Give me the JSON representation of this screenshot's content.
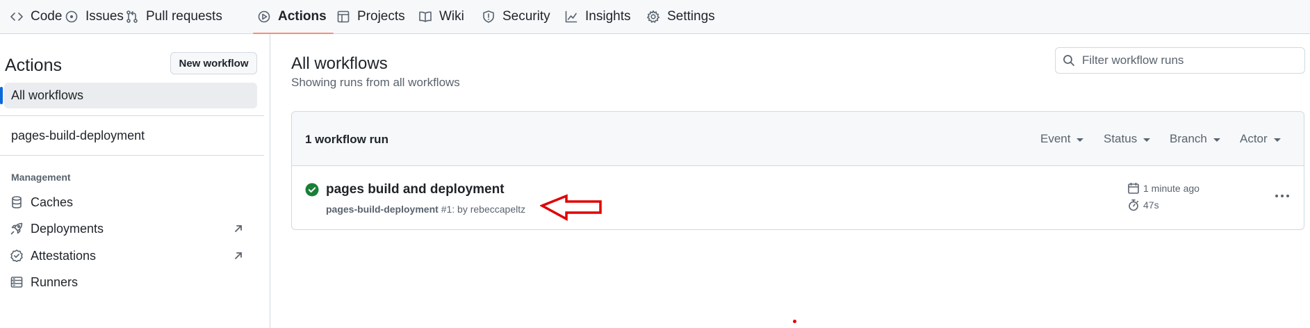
{
  "nav": {
    "tabs": [
      {
        "label": "Code",
        "icon": "code-icon"
      },
      {
        "label": "Issues",
        "icon": "issue-opened-icon"
      },
      {
        "label": "Pull requests",
        "icon": "git-pull-request-icon"
      },
      {
        "label": "Actions",
        "icon": "play-icon",
        "active": true
      },
      {
        "label": "Projects",
        "icon": "table-icon"
      },
      {
        "label": "Wiki",
        "icon": "book-icon"
      },
      {
        "label": "Security",
        "icon": "shield-icon"
      },
      {
        "label": "Insights",
        "icon": "graph-icon"
      },
      {
        "label": "Settings",
        "icon": "gear-icon"
      }
    ]
  },
  "sidebar": {
    "title": "Actions",
    "new_workflow_label": "New workflow",
    "all_workflows_label": "All workflows",
    "workflows": [
      {
        "label": "pages-build-deployment"
      }
    ],
    "management_heading": "Management",
    "management_items": [
      {
        "label": "Caches",
        "icon": "database-icon"
      },
      {
        "label": "Deployments",
        "icon": "rocket-icon",
        "external": true
      },
      {
        "label": "Attestations",
        "icon": "verified-icon",
        "external": true
      },
      {
        "label": "Runners",
        "icon": "server-icon"
      }
    ]
  },
  "main": {
    "title": "All workflows",
    "subtitle": "Showing runs from all workflows",
    "filter_placeholder": "Filter workflow runs",
    "runs_count": "1 workflow run",
    "filters": [
      "Event",
      "Status",
      "Branch",
      "Actor"
    ],
    "runs": [
      {
        "title": "pages build and deployment",
        "workflow": "pages-build-deployment",
        "number": "#1",
        "by_text": ": by rebeccapeltz",
        "time_ago": "1 minute ago",
        "duration": "47s",
        "status": "success"
      }
    ]
  },
  "colors": {
    "accent_underline": "#fd8c73",
    "success": "#1a7f37",
    "annotation_red": "#e00000",
    "selected_bar": "#0969da"
  }
}
